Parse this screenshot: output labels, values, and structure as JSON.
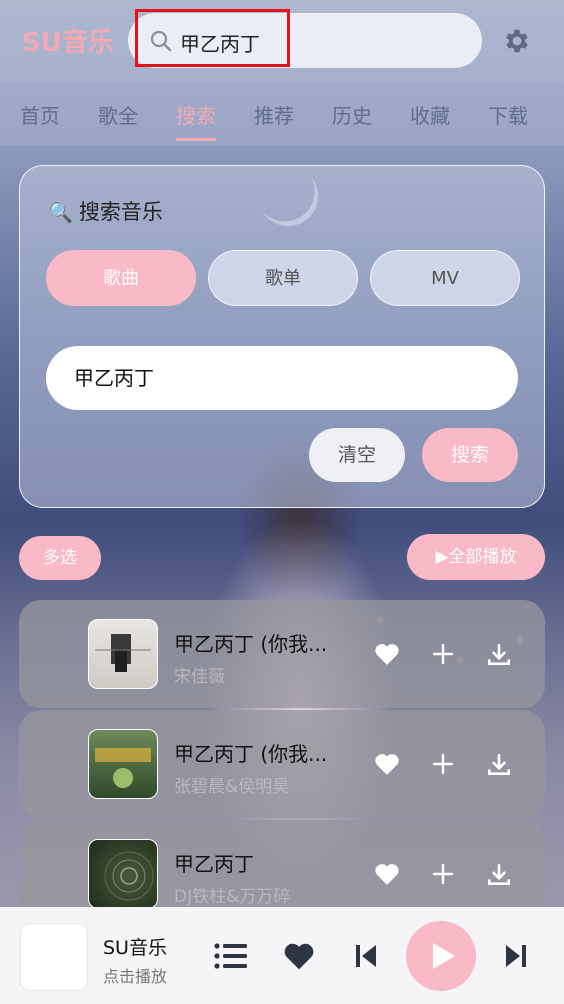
{
  "header": {
    "app_title": "SU音乐",
    "search_value": "甲乙丙丁",
    "settings_icon": "gear-icon",
    "search_icon": "search-icon"
  },
  "tabs": [
    {
      "label": "首页"
    },
    {
      "label": "歌全"
    },
    {
      "label": "搜索",
      "active": true
    },
    {
      "label": "推荐"
    },
    {
      "label": "历史"
    },
    {
      "label": "收藏"
    },
    {
      "label": "下载"
    }
  ],
  "search_panel": {
    "title": "搜索音乐",
    "title_icon": "magnifier-emoji",
    "types": [
      {
        "label": "歌曲",
        "active": true
      },
      {
        "label": "歌单"
      },
      {
        "label": "MV"
      }
    ],
    "query": "甲乙丙丁",
    "clear_label": "清空",
    "search_label": "搜索"
  },
  "list_actions": {
    "multi_select": "多选",
    "play_all": "全部播放"
  },
  "songs": [
    {
      "title": "甲乙丙丁 (你我...",
      "artist": "宋佳薇"
    },
    {
      "title": "甲乙丙丁 (你我...",
      "artist": "张碧晨&侯明昊"
    },
    {
      "title": "甲乙丙丁",
      "artist": "DJ铁柱&万万碎"
    }
  ],
  "player": {
    "name": "SU音乐",
    "status": "点击播放"
  },
  "colors": {
    "accent": "#f9b9c6",
    "brand": "#f4a7b5"
  }
}
